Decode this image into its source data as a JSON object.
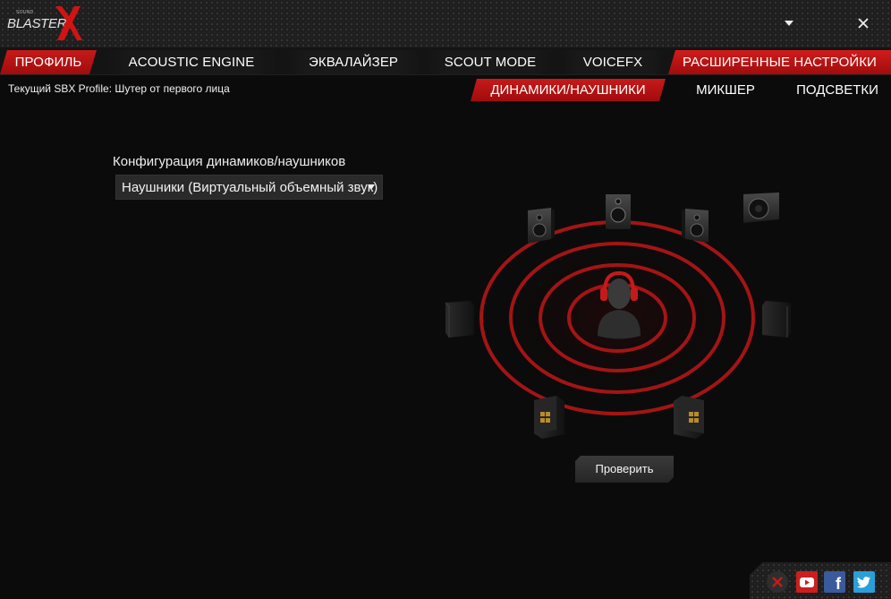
{
  "app": {
    "logo_small": "SOUND",
    "logo_word": "BLASTER",
    "minimize_icon": "chevron-down-icon",
    "close_icon": "close-icon"
  },
  "tabs": [
    {
      "label": "ПРОФИЛЬ",
      "state": "active"
    },
    {
      "label": "ACOUSTIC ENGINE",
      "state": "plain"
    },
    {
      "label": "ЭКВАЛАЙЗЕР",
      "state": "plain"
    },
    {
      "label": "SCOUT MODE",
      "state": "plain"
    },
    {
      "label": "VOICEFX",
      "state": "plain"
    },
    {
      "label": "РАСШИРЕННЫЕ НАСТРОЙКИ",
      "state": "highlighted"
    }
  ],
  "profile": {
    "current_text": "Текущий SBX Profile: Шутер от первого лица"
  },
  "subtabs": [
    {
      "label": "ДИНАМИКИ/НАУШНИКИ",
      "state": "active"
    },
    {
      "label": "МИКШЕР",
      "state": "plain"
    },
    {
      "label": "ПОДСВЕТКИ",
      "state": "plain"
    }
  ],
  "config": {
    "label": "Конфигурация динамиков/наушников",
    "selected": "Наушники (Виртуальный объемный звук)"
  },
  "test_button": "Проверить",
  "colors": {
    "accent": "#b71414",
    "ring": "#c81c1c",
    "youtube": "#cc1e1e",
    "facebook": "#3a5a9c",
    "twitter": "#2a9fd8"
  },
  "social": {
    "icons": [
      "close-circle-icon",
      "youtube-icon",
      "facebook-icon",
      "twitter-icon"
    ],
    "facebook_glyph": "f"
  }
}
